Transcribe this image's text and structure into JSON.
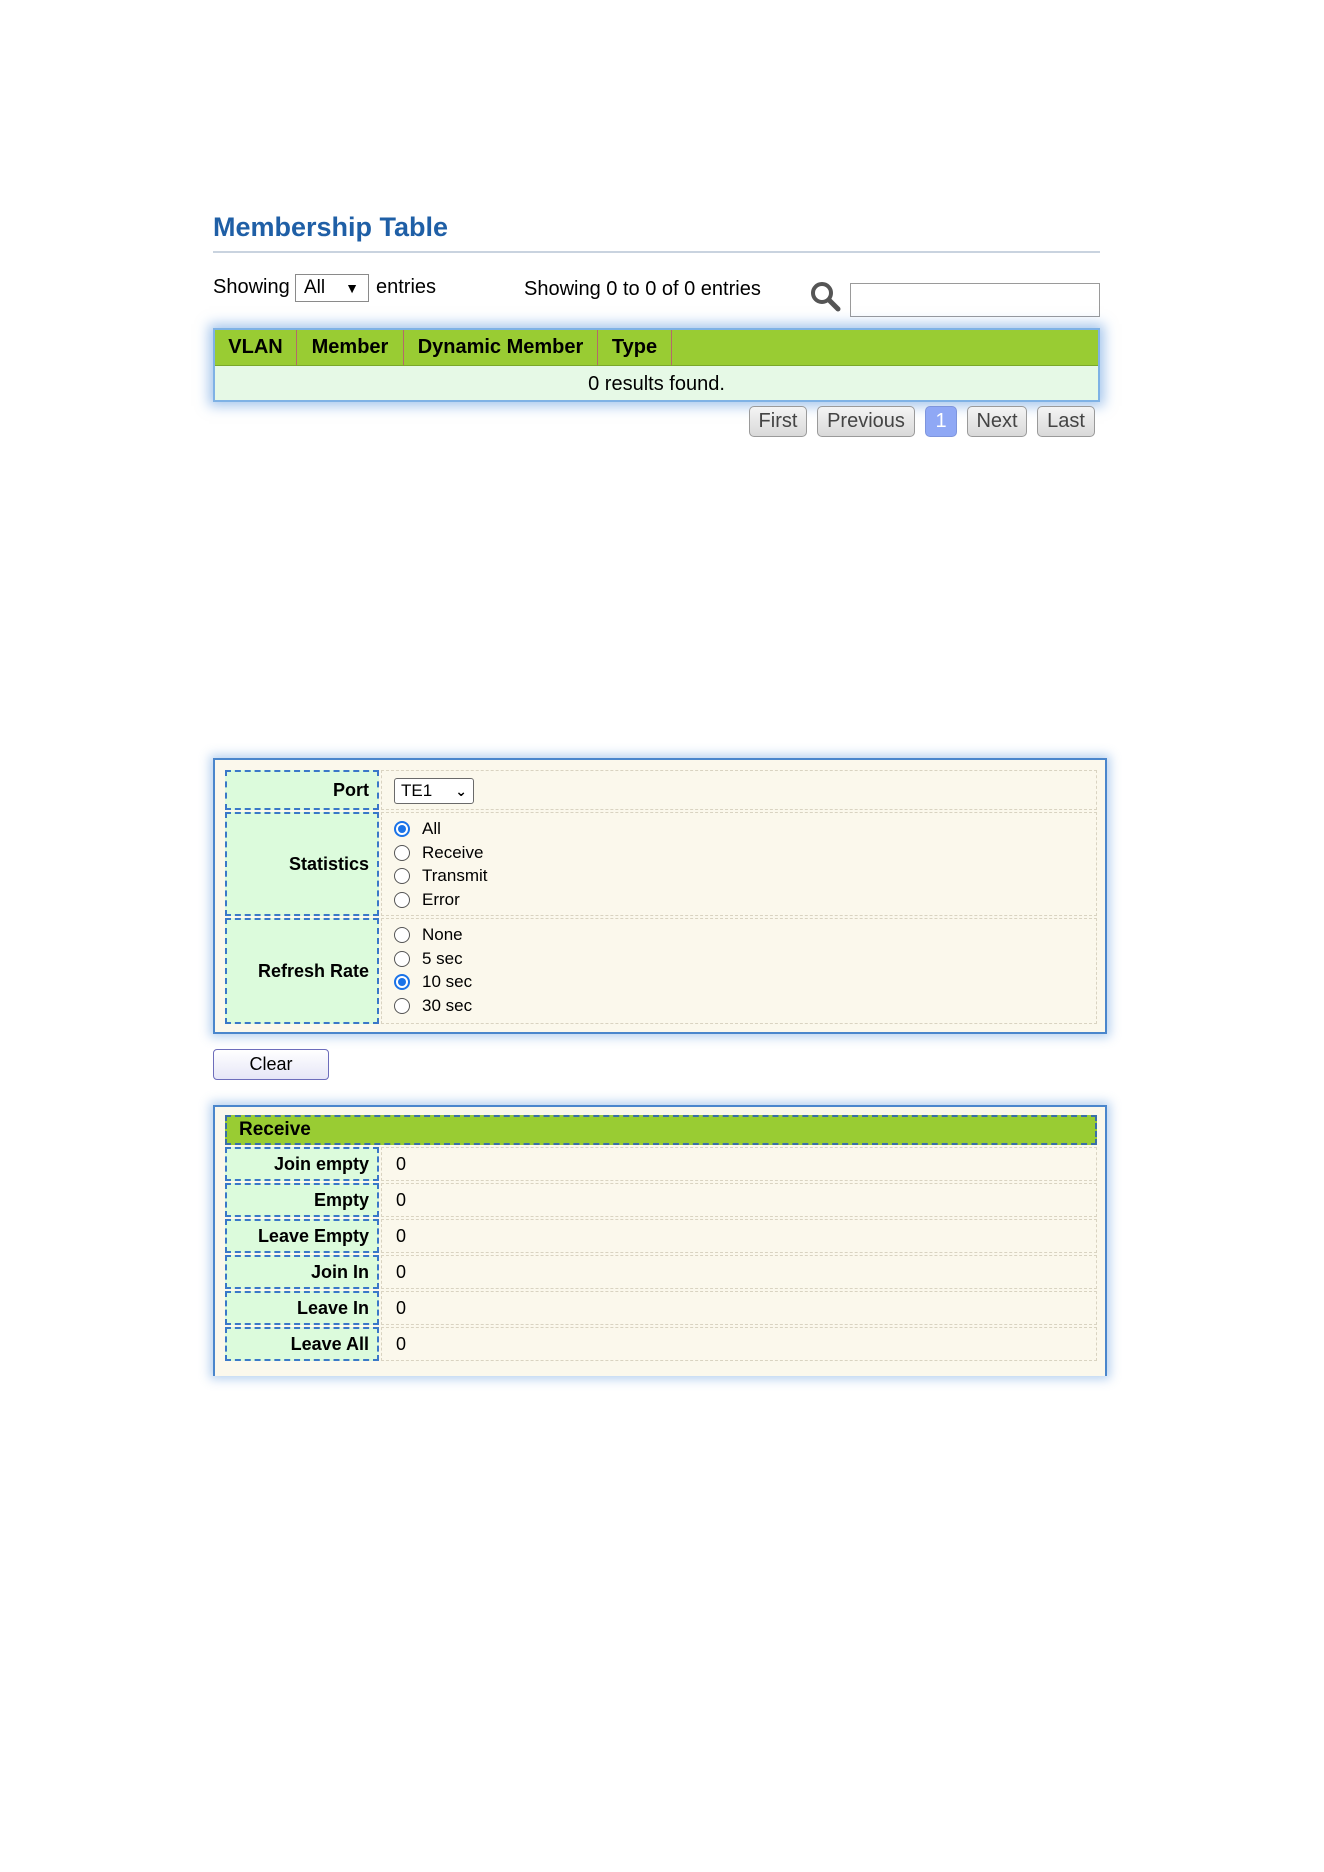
{
  "membership": {
    "title": "Membership Table",
    "showing_label": "Showing",
    "entries_select": "All",
    "entries_label": "entries",
    "summary": "Showing 0 to 0 of 0 entries",
    "search_placeholder": "",
    "columns": [
      "VLAN",
      "Member",
      "Dynamic Member",
      "Type"
    ],
    "empty_message": "0 results found.",
    "pager": [
      "First",
      "Previous",
      "1",
      "Next",
      "Last"
    ],
    "pager_active": "1"
  },
  "settings": {
    "port_label": "Port",
    "port_value": "TE1",
    "statistics_label": "Statistics",
    "statistics_options": [
      "All",
      "Receive",
      "Transmit",
      "Error"
    ],
    "statistics_selected": "All",
    "refresh_label": "Refresh Rate",
    "refresh_options": [
      "None",
      "5 sec",
      "10 sec",
      "30 sec"
    ],
    "refresh_selected": "10 sec"
  },
  "clear_button": "Clear",
  "receive": {
    "title": "Receive",
    "rows": [
      {
        "label": "Join empty",
        "value": "0"
      },
      {
        "label": "Empty",
        "value": "0"
      },
      {
        "label": "Leave Empty",
        "value": "0"
      },
      {
        "label": "Join In",
        "value": "0"
      },
      {
        "label": "Leave In",
        "value": "0"
      },
      {
        "label": "Leave All",
        "value": "0"
      }
    ]
  },
  "colors": {
    "title": "#1f5fa6",
    "header_green": "#99cc33",
    "label_cell": "#dcfbdc",
    "panel_bg": "#fbf8ec",
    "accent_blue": "#1a73e8"
  }
}
